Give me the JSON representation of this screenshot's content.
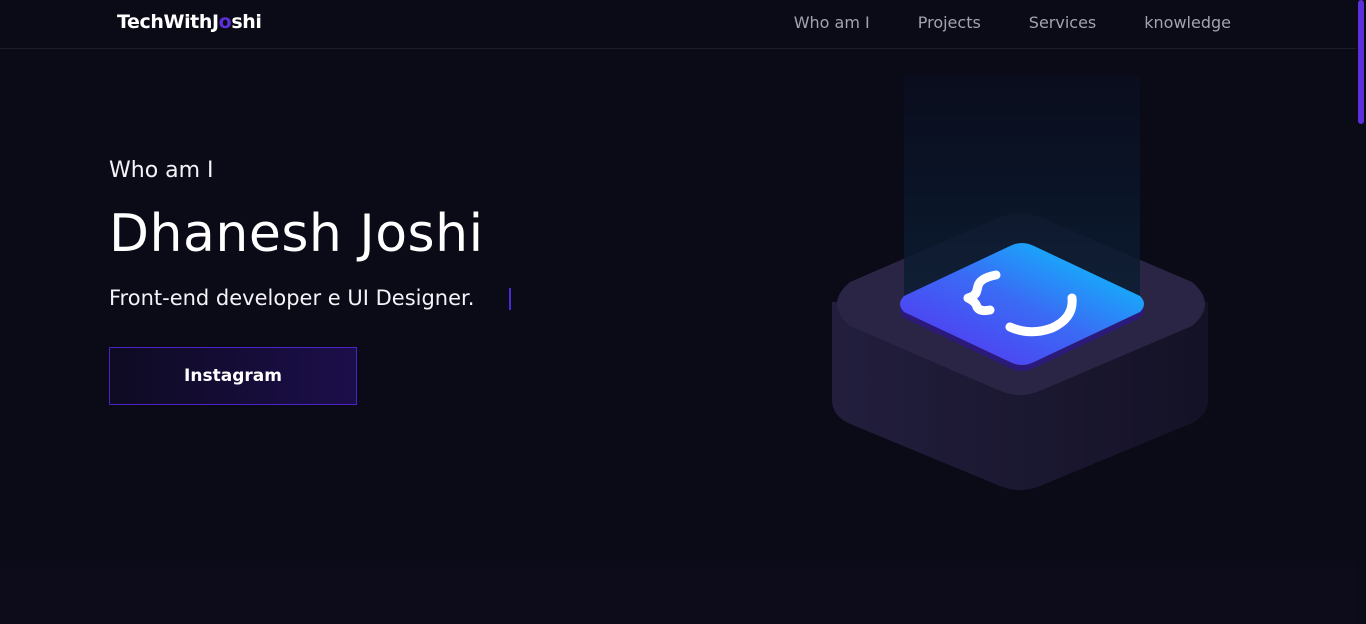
{
  "header": {
    "logo_prefix": "TechWithJ",
    "logo_accent": "o",
    "logo_suffix": "shi",
    "nav": [
      {
        "label": "Who am I"
      },
      {
        "label": "Projects"
      },
      {
        "label": "Services"
      },
      {
        "label": "knowledge"
      }
    ]
  },
  "hero": {
    "kicker": "Who am I",
    "title": "Dhanesh Joshi",
    "subtitle": "Front-end developer e UI Designer.",
    "cta_label": "Instagram"
  },
  "illustration": {
    "icon": "code-braces-icon"
  },
  "colors": {
    "background": "#0b0a17",
    "accent": "#5b2fd9",
    "cyan": "#00d0ff",
    "nav_text": "#a3a3b0"
  }
}
